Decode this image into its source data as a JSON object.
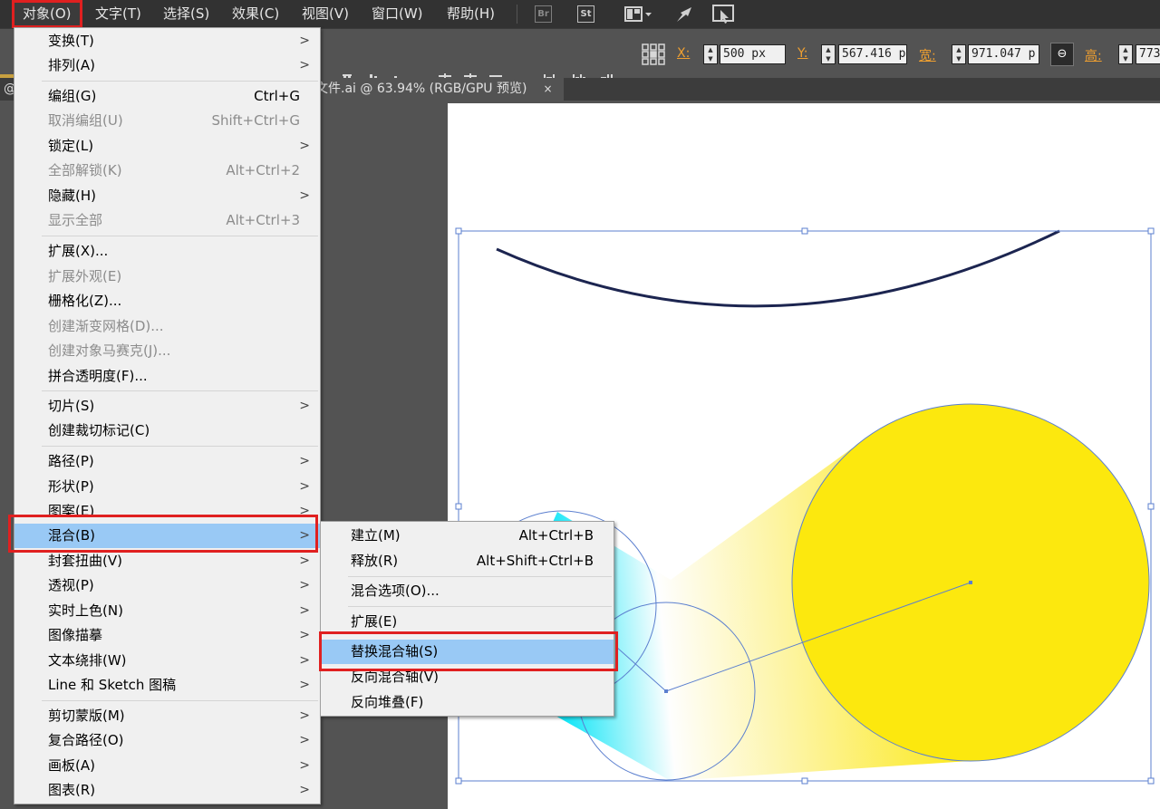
{
  "menubar": {
    "items": [
      "对象(O)",
      "文字(T)",
      "选择(S)",
      "效果(C)",
      "视图(V)",
      "窗口(W)",
      "帮助(H)"
    ],
    "icons": [
      "Br",
      "St"
    ]
  },
  "controlbar": {
    "x_label": "X:",
    "x_value": "500 px",
    "y_label": "Y:",
    "y_value": "567.416 p",
    "w_label": "宽:",
    "w_value": "971.047 p",
    "h_label": "高:",
    "h_value": "773"
  },
  "document_tab": {
    "left_label": "@",
    "title": "文件.ai @ 63.94% (RGB/GPU 预览)",
    "close": "×"
  },
  "object_menu": {
    "items": [
      {
        "label": "变换(T)",
        "arrow": ">"
      },
      {
        "label": "排列(A)",
        "arrow": ">"
      },
      {
        "label": "编组(G)",
        "shortcut": "Ctrl+G"
      },
      {
        "label": "取消编组(U)",
        "shortcut": "Shift+Ctrl+G",
        "disabled": true
      },
      {
        "label": "锁定(L)",
        "arrow": ">"
      },
      {
        "label": "全部解锁(K)",
        "shortcut": "Alt+Ctrl+2",
        "disabled": true
      },
      {
        "label": "隐藏(H)",
        "arrow": ">"
      },
      {
        "label": "显示全部",
        "shortcut": "Alt+Ctrl+3",
        "disabled": true
      },
      {
        "label": "扩展(X)..."
      },
      {
        "label": "扩展外观(E)",
        "disabled": true
      },
      {
        "label": "栅格化(Z)..."
      },
      {
        "label": "创建渐变网格(D)...",
        "disabled": true
      },
      {
        "label": "创建对象马赛克(J)...",
        "disabled": true
      },
      {
        "label": "拼合透明度(F)..."
      },
      {
        "label": "切片(S)",
        "arrow": ">"
      },
      {
        "label": "创建裁切标记(C)"
      },
      {
        "label": "路径(P)",
        "arrow": ">"
      },
      {
        "label": "形状(P)",
        "arrow": ">"
      },
      {
        "label": "图案(E)",
        "arrow": ">"
      },
      {
        "label": "混合(B)",
        "arrow": ">",
        "highlighted": true
      },
      {
        "label": "封套扭曲(V)",
        "arrow": ">"
      },
      {
        "label": "透视(P)",
        "arrow": ">"
      },
      {
        "label": "实时上色(N)",
        "arrow": ">"
      },
      {
        "label": "图像描摹",
        "arrow": ">"
      },
      {
        "label": "文本绕排(W)",
        "arrow": ">"
      },
      {
        "label": "Line 和 Sketch 图稿",
        "arrow": ">"
      },
      {
        "label": "剪切蒙版(M)",
        "arrow": ">"
      },
      {
        "label": "复合路径(O)",
        "arrow": ">"
      },
      {
        "label": "画板(A)",
        "arrow": ">"
      },
      {
        "label": "图表(R)",
        "arrow": ">"
      }
    ]
  },
  "blend_submenu": {
    "items": [
      {
        "label": "建立(M)",
        "shortcut": "Alt+Ctrl+B"
      },
      {
        "label": "释放(R)",
        "shortcut": "Alt+Shift+Ctrl+B"
      },
      {
        "label": "混合选项(O)..."
      },
      {
        "label": "扩展(E)"
      },
      {
        "label": "替换混合轴(S)",
        "highlighted": true
      },
      {
        "label": "反向混合轴(V)"
      },
      {
        "label": "反向堆叠(F)"
      }
    ]
  },
  "colors": {
    "highlight": "#99c9f5",
    "annotation_red": "#e02020",
    "yellow": "#fce80e",
    "cyan": "#16e6f7",
    "selection_blue": "#4a7bd0"
  }
}
